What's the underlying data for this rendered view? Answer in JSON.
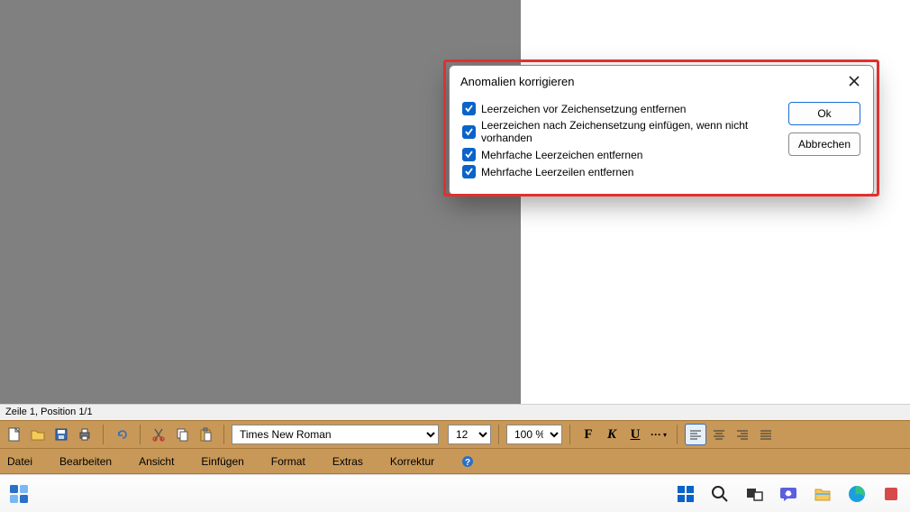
{
  "status_bar": {
    "text": "Zeile 1, Position 1/1"
  },
  "toolbar": {
    "font_name": "Times New Roman",
    "font_size": "12",
    "zoom": "100 %"
  },
  "format_buttons": {
    "bold": "F",
    "italic": "K",
    "underline": "U",
    "more": "···"
  },
  "menubar": {
    "items": [
      "Datei",
      "Bearbeiten",
      "Ansicht",
      "Einfügen",
      "Format",
      "Extras",
      "Korrektur"
    ]
  },
  "dialog": {
    "title": "Anomalien korrigieren",
    "options": [
      "Leerzeichen vor Zeichensetzung entfernen",
      "Leerzeichen nach Zeichensetzung einfügen, wenn nicht vorhanden",
      "Mehrfache Leerzeichen entfernen",
      "Mehrfache Leerzeilen entfernen"
    ],
    "ok": "Ok",
    "cancel": "Abbrechen"
  }
}
